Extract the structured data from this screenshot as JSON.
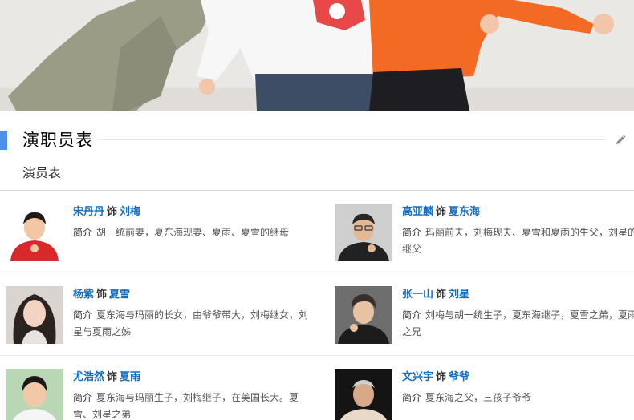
{
  "section": {
    "title": "演职员表",
    "subtitle": "演员表",
    "edit_icon": "pencil-icon"
  },
  "intro_label": "简介",
  "as_label": "饰",
  "cast": [
    {
      "actor": "宋丹丹",
      "role": "刘梅",
      "intro": "胡一统前妻，夏东海现妻、夏雨、夏雪的继母"
    },
    {
      "actor": "高亚麟",
      "role": "夏东海",
      "intro": "玛丽前夫，刘梅现夫、夏雪和夏雨的生父，刘星的继父"
    },
    {
      "actor": "杨紫",
      "role": "夏雪",
      "intro": "夏东海与玛丽的长女，由爷爷带大，刘梅继女，刘星与夏雨之姊"
    },
    {
      "actor": "张一山",
      "role": "刘星",
      "intro": "刘梅与胡一统生子，夏东海继子，夏雪之弟，夏雨之兄"
    },
    {
      "actor": "尤浩然",
      "role": "夏雨",
      "intro": "夏东海与玛丽生子，刘梅继子，在美国长大。夏雪、刘星之弟"
    },
    {
      "actor": "文兴宇",
      "role": "爷爷",
      "intro": "夏东海之父，三孩子爷爷"
    }
  ]
}
